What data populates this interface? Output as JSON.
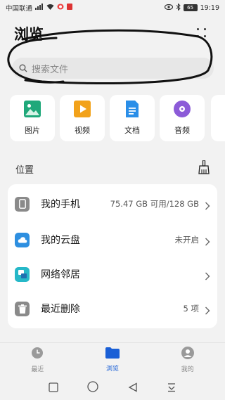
{
  "status_bar": {
    "carrier": "中国联通",
    "time": "19:19",
    "battery": "65"
  },
  "header": {
    "title": "浏览"
  },
  "search": {
    "placeholder": "搜索文件"
  },
  "categories": [
    {
      "label": "图片",
      "icon": "image-icon",
      "color": "#1fa87a"
    },
    {
      "label": "视频",
      "icon": "video-icon",
      "color": "#f2a21a"
    },
    {
      "label": "文档",
      "icon": "document-icon",
      "color": "#2a8ee8"
    },
    {
      "label": "音频",
      "icon": "audio-icon",
      "color": "#8c5bd8"
    }
  ],
  "location": {
    "label": "位置",
    "items": [
      {
        "label": "我的手机",
        "value": "75.47 GB 可用/128 GB",
        "icon": "phone-icon"
      },
      {
        "label": "我的云盘",
        "value": "未开启",
        "icon": "cloud-icon"
      },
      {
        "label": "网络邻居",
        "value": "",
        "icon": "network-icon"
      },
      {
        "label": "最近删除",
        "value": "5 项",
        "icon": "trash-icon"
      }
    ]
  },
  "bottom_nav": [
    {
      "label": "最近",
      "active": false
    },
    {
      "label": "浏览",
      "active": true
    },
    {
      "label": "我的",
      "active": false
    }
  ],
  "colors": {
    "accent": "#1a5fd6",
    "background": "#f2f2f2"
  }
}
